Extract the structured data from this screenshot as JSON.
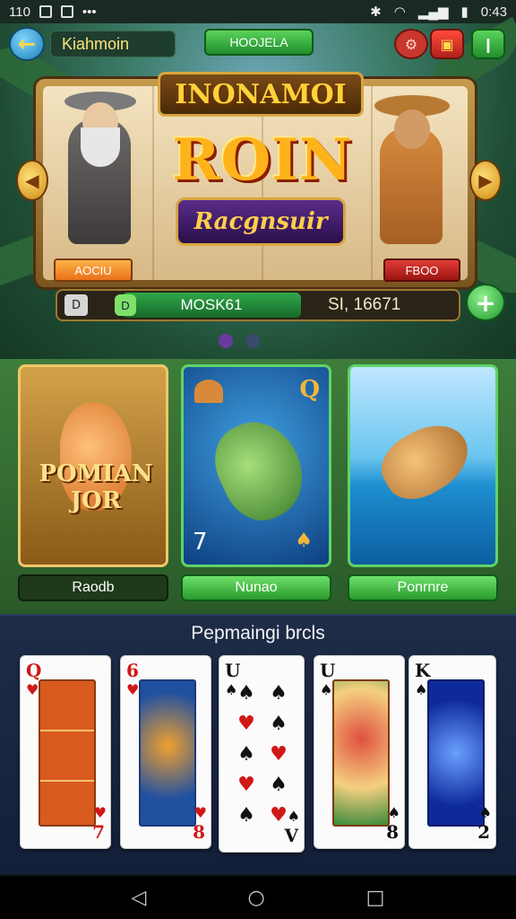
{
  "status_bar": {
    "left_text": "110",
    "time": "0:43"
  },
  "top_bar": {
    "back_icon": "back-arrow-icon",
    "title": "Kiahmoin",
    "center_label": "HOOJELA"
  },
  "slot": {
    "header": "INONAMOI",
    "main_title": "ROIN",
    "subtitle": "Racgnsuir",
    "left_tag": "AOCIU",
    "right_tag": "FBOO"
  },
  "balance": {
    "left_chip": "D",
    "green_chip": "D",
    "label": "MOSK61",
    "amount": "SI, 16671"
  },
  "game_cards": [
    {
      "art_text": "POMIAN JOR",
      "button": "Raodb"
    },
    {
      "corner_rank": "Q",
      "corner_number": "7",
      "button": "Nunao"
    },
    {
      "button": "Ponrnre"
    }
  ],
  "panel": {
    "title": "Pepmaingi brcls",
    "cards": [
      {
        "rank": "Q",
        "suit": "♥",
        "rank_bottom": "7",
        "suit_bottom": "♥"
      },
      {
        "rank": "6",
        "suit": "♥",
        "rank_bottom": "8",
        "suit_bottom": "♥"
      },
      {
        "rank": "U",
        "suit": "♠",
        "rank_bottom": "V",
        "suit_bottom": "♠"
      },
      {
        "rank": "U",
        "suit": "♠",
        "rank_bottom": "8",
        "suit_bottom": "♠"
      },
      {
        "rank": "K",
        "suit": "♠",
        "rank_bottom": "2",
        "suit_bottom": "♠"
      }
    ]
  },
  "nav": {
    "back": "◁",
    "home": "○",
    "recents": "□"
  },
  "colors": {
    "accent_green": "#2a9a2c",
    "accent_gold": "#d8a640",
    "panel_bg": "#1e2c48"
  }
}
